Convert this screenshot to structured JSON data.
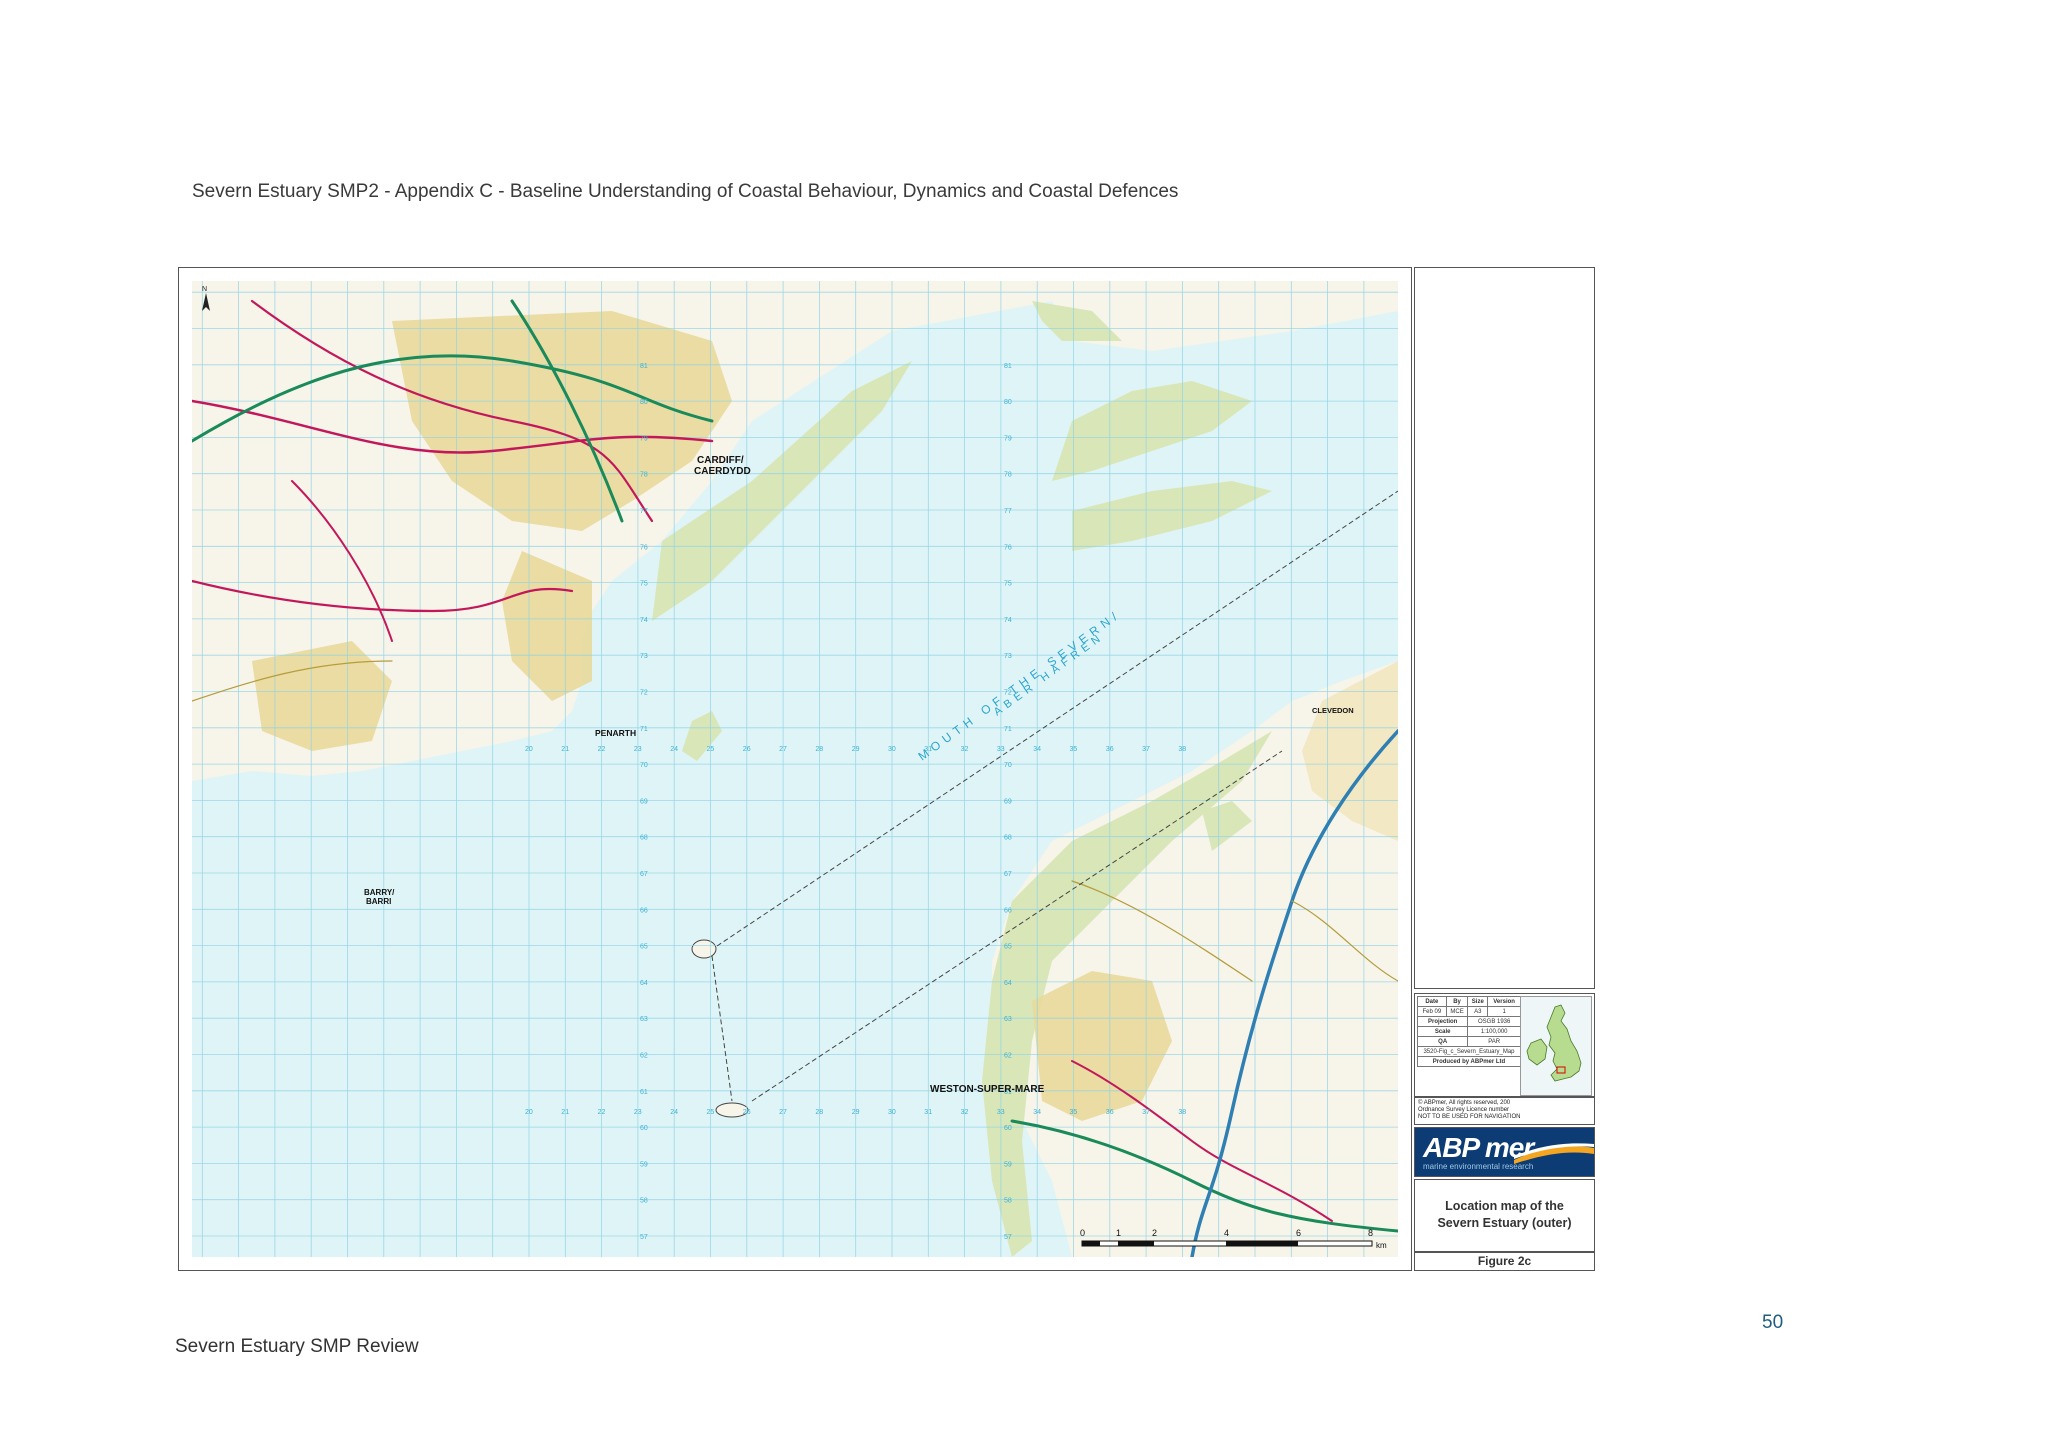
{
  "header": {
    "title": "Severn Estuary SMP2 - Appendix C - Baseline Understanding of Coastal Behaviour, Dynamics and Coastal Defences"
  },
  "footer": {
    "text": "Severn Estuary SMP Review",
    "page_number": "50"
  },
  "map": {
    "place_labels": {
      "cardiff": "CARDIFF/\nCAERDYDD",
      "penarth": "PENARTH",
      "barry": "BARRY/\nBARRI",
      "weston": "WESTON-SUPER-MARE",
      "clevedon": "CLEVEDON"
    },
    "water_label_1": "MOUTH OF THE SEVERN/",
    "water_label_2": "ABER HAFREN",
    "scale_bar": {
      "ticks": [
        "0",
        "1",
        "2",
        "4",
        "6",
        "8"
      ],
      "unit": "km"
    },
    "north_arrow": "N",
    "grid_eastings": [
      "20",
      "21",
      "22",
      "23",
      "24",
      "25",
      "26",
      "27",
      "28",
      "29",
      "30",
      "31",
      "32",
      "33",
      "34",
      "35",
      "36",
      "37",
      "38"
    ],
    "grid_northings": [
      "57",
      "58",
      "59",
      "60",
      "61",
      "62",
      "63",
      "64",
      "65",
      "66",
      "67",
      "68",
      "69",
      "70",
      "71",
      "72",
      "73",
      "74",
      "75",
      "76",
      "77",
      "78",
      "79",
      "80",
      "81"
    ]
  },
  "info_table": {
    "headers": [
      "Date",
      "By",
      "Size",
      "Version"
    ],
    "values": [
      "Feb 09",
      "MCE",
      "A3",
      "1"
    ],
    "projection_label": "Projection",
    "projection": "OSGB 1936",
    "scale_label": "Scale",
    "scale": "1:100,000",
    "qa_label": "QA",
    "qa": "PAR",
    "filename": "3520-Fig_c_Severn_Estuary_Map",
    "produced_by": "Produced by ABPmer Ltd"
  },
  "copyright": {
    "line1": "© ABPmer, All rights reserved, 200",
    "line2": "Ordnance Survey Licence number",
    "line3": "NOT TO BE USED FOR NAVIGATION"
  },
  "logo": {
    "main": "ABP mer",
    "sub": "marine environmental research"
  },
  "figure": {
    "title_line1": "Location map of the",
    "title_line2": "Severn Estuary (outer)",
    "label": "Figure 2c"
  },
  "colors": {
    "sea": "#dff4f6",
    "land": "#f7f4ea",
    "intertidal": "#d9e6b8",
    "grid": "#8fd3e6",
    "road_a": "#c2185b",
    "road_primary": "#1b8a5a",
    "urban": "#d8c072",
    "page_number": "#1f5d80"
  }
}
